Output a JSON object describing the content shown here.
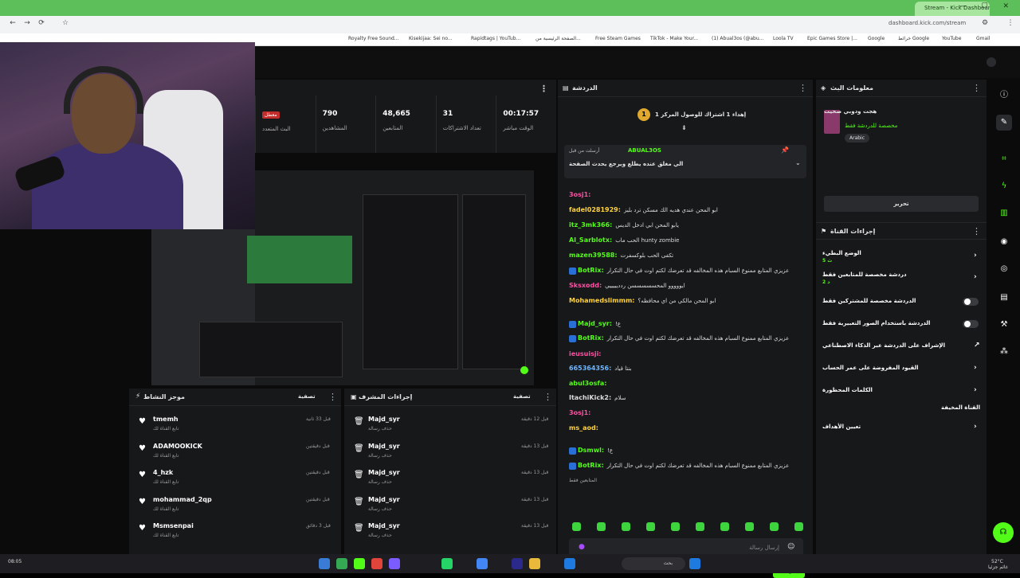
{
  "browser": {
    "active_tab": "Stream - Kick Dashboard",
    "url": "dashboard.kick.com/stream",
    "bookmarks": [
      "Royalty Free Sound...",
      "Kisekijaa: Sei no...",
      "Rapidtags | YouTub...",
      "الصفحة الرئيسية من...",
      "Free Steam Games",
      "TikTok - Make Your...",
      "(1) Abual3os (@abu...",
      "Loola TV",
      "Epic Games Store |...",
      "Google",
      "خرائط Google",
      "YouTube",
      "Gmail"
    ]
  },
  "stats": [
    {
      "value": "00:17:57",
      "label": "الوقت مباشر"
    },
    {
      "value": "31",
      "label": "تعداد الاشتراكات"
    },
    {
      "value": "48,665",
      "label": "المتابعين"
    },
    {
      "value": "790",
      "label": "المشاهدين"
    },
    {
      "value": "معطل",
      "label": "البث المتعدد"
    }
  ],
  "activity": {
    "title": "موجز النشاط",
    "filter": "تصفية",
    "items": [
      {
        "name": "tmemh",
        "sub": "تابع القناة لك",
        "time": "قبل 33 ثانية"
      },
      {
        "name": "ADAMOOKICK",
        "sub": "تابع القناة لك",
        "time": "قبل دقيقتين"
      },
      {
        "name": "4_hzk",
        "sub": "تابع القناة لك",
        "time": "قبل دقيقتين"
      },
      {
        "name": "mohammad_2qp",
        "sub": "تابع القناة لك",
        "time": "قبل دقيقتين"
      },
      {
        "name": "Msmsenpai",
        "sub": "تابع القناة لك",
        "time": "قبل 3 دقائق"
      }
    ]
  },
  "mod_actions": {
    "title": "إجراءات المشرف",
    "filter": "تصفية",
    "items": [
      {
        "name": "Majd_syr",
        "sub": "حذف رسالة",
        "time": "قبل 12 دقيقة"
      },
      {
        "name": "Majd_syr",
        "sub": "حذف رسالة",
        "time": "قبل 13 دقيقة"
      },
      {
        "name": "Majd_syr",
        "sub": "حذف رسالة",
        "time": "قبل 13 دقيقة"
      },
      {
        "name": "Majd_syr",
        "sub": "حذف رسالة",
        "time": "قبل 13 دقيقة"
      },
      {
        "name": "Majd_syr",
        "sub": "حذف رسالة",
        "time": "قبل 13 دقيقة"
      }
    ]
  },
  "chat": {
    "title": "الدردشة",
    "goal": "إهداء 1 اشتراك للوصول المركز 1",
    "pinned_by": "ABUAL3OS",
    "pinned_prefix": "أرسلت من قبل",
    "pinned_text": "الي مغلق عنده يطلع ويرجع يحدث الصفحة",
    "messages": [
      {
        "user": "3osj1:",
        "text": "",
        "color": "#ff4fa3"
      },
      {
        "user": "fadel0281929:",
        "text": "ابو المحن عندي هديه الك مسكن ترد بليز",
        "color": "#ffd23c"
      },
      {
        "user": "itz_3mk366:",
        "text": "يابو المحن ابي ادخل الديس",
        "color": "#53fc18"
      },
      {
        "user": "Al_Sarblotx:",
        "text": "الحب ماب hunty zombie",
        "color": "#53fc18"
      },
      {
        "user": "mazen39588:",
        "text": "تكفى الحب بلوكسفرت",
        "color": "#53fc18"
      },
      {
        "user": "BotRix:",
        "text": "عزيزي المتابع ممنوع السبام هذه المخالفه قد تعرضك لكتم اوت في حال التكرار",
        "color": "#53fc18"
      },
      {
        "user": "Sksxodd:",
        "text": "ايووووو المحسسسسسن ردديييييي",
        "color": "#ff4fa3"
      },
      {
        "user": "Mohamedslimmm:",
        "text": "ابو المحن مالكي من اي محافظه؟",
        "color": "#ffd23c"
      },
      {
        "user": "Majd_syr:",
        "text": "!ع",
        "color": "#53fc18"
      },
      {
        "user": "BotRix:",
        "text": "عزيزي المتابع ممنوع السبام هذه المخالفه قد تعرضك لكتم اوت في حال التكرار",
        "color": "#53fc18"
      },
      {
        "user": "ieusuisji:",
        "text": "",
        "color": "#ff4fa3"
      },
      {
        "user": "665364356:",
        "text": "بنتا قياد",
        "color": "#6fb6ff"
      },
      {
        "user": "abul3osfa:",
        "text": "",
        "color": "#53fc18"
      },
      {
        "user": "ItachiKick2:",
        "text": "سلام",
        "color": "#dddddd"
      },
      {
        "user": "3osj1:",
        "text": "",
        "color": "#ff4fa3"
      },
      {
        "user": "ms_aod:",
        "text": "",
        "color": "#ffd23c"
      },
      {
        "user": "Dsmwl:",
        "text": "!ع",
        "color": "#53fc18"
      },
      {
        "user": "BotRix:",
        "text": "عزيزي المتابع ممنوع السبام هذه المخالفه قد تعرضك لكتم اوت في حال التكرار",
        "color": "#53fc18"
      }
    ],
    "followers_only": "المتابعين فقط",
    "input_placeholder": "إرسال رسالة",
    "send_label": "الدردشة"
  },
  "stream_info": {
    "title": "معلومات البث",
    "stream_title": "هجت ودوبي صحيت",
    "category": "مخصصة للدردشة فقط",
    "tag": "Arabic",
    "edit_label": "تحرير"
  },
  "channel_actions": {
    "title": "إجراءات القناة",
    "items": [
      {
        "label": "الوضع البطيء",
        "sub": "5 ث",
        "control": "chevron"
      },
      {
        "label": "دردشة مخصصة للمتابعين فقط",
        "sub": "2 د",
        "control": "chevron"
      },
      {
        "label": "الدردشة مخصصة للمشتركين فقط",
        "sub": "",
        "control": "toggle"
      },
      {
        "label": "الدردشة باستخدام الصور التعبيرية فقط",
        "sub": "",
        "control": "toggle"
      },
      {
        "label": "الإشراف على الدردشة عبر الذكاء الاصطناعي",
        "sub": "",
        "control": "external"
      },
      {
        "label": "القيود المفروضة على عمر الحساب",
        "sub": "",
        "control": "chevron"
      },
      {
        "label": "الكلمات المحظورة",
        "sub": "",
        "control": "chevron"
      },
      {
        "label": "القناة المخيفة",
        "sub": "",
        "control": "none"
      },
      {
        "label": "تعيين الأهداف",
        "sub": "",
        "control": "chevron"
      }
    ]
  },
  "taskbar": {
    "search": "بحث",
    "time": "08:05",
    "temp": "52°C",
    "weather": "غائم جزئيا"
  },
  "colors": {
    "accent": "#53fc18",
    "panel": "#17181a",
    "live": "#c42b2b"
  }
}
